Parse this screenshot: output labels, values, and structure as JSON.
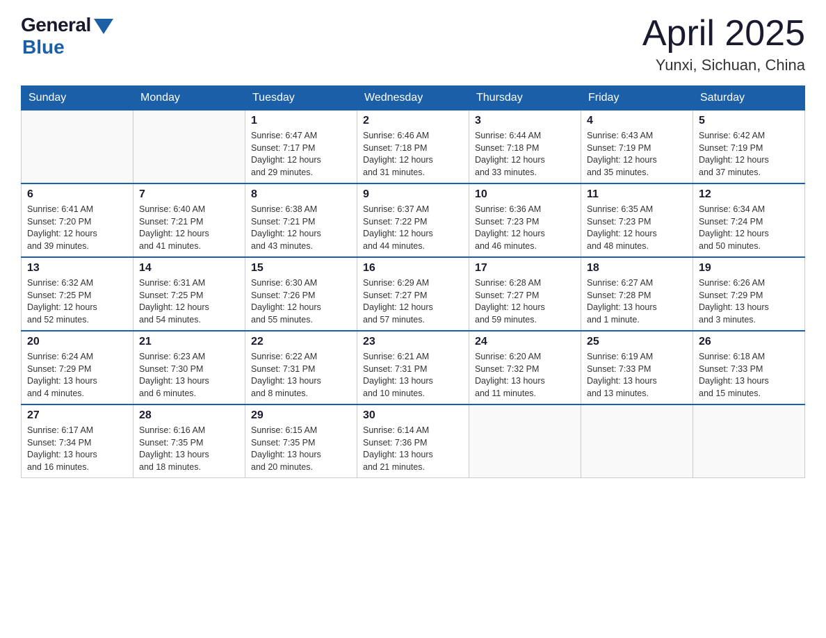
{
  "header": {
    "logo": {
      "general": "General",
      "blue": "Blue"
    },
    "title": "April 2025",
    "location": "Yunxi, Sichuan, China"
  },
  "days_of_week": [
    "Sunday",
    "Monday",
    "Tuesday",
    "Wednesday",
    "Thursday",
    "Friday",
    "Saturday"
  ],
  "weeks": [
    [
      {
        "day": "",
        "info": ""
      },
      {
        "day": "",
        "info": ""
      },
      {
        "day": "1",
        "info": "Sunrise: 6:47 AM\nSunset: 7:17 PM\nDaylight: 12 hours\nand 29 minutes."
      },
      {
        "day": "2",
        "info": "Sunrise: 6:46 AM\nSunset: 7:18 PM\nDaylight: 12 hours\nand 31 minutes."
      },
      {
        "day": "3",
        "info": "Sunrise: 6:44 AM\nSunset: 7:18 PM\nDaylight: 12 hours\nand 33 minutes."
      },
      {
        "day": "4",
        "info": "Sunrise: 6:43 AM\nSunset: 7:19 PM\nDaylight: 12 hours\nand 35 minutes."
      },
      {
        "day": "5",
        "info": "Sunrise: 6:42 AM\nSunset: 7:19 PM\nDaylight: 12 hours\nand 37 minutes."
      }
    ],
    [
      {
        "day": "6",
        "info": "Sunrise: 6:41 AM\nSunset: 7:20 PM\nDaylight: 12 hours\nand 39 minutes."
      },
      {
        "day": "7",
        "info": "Sunrise: 6:40 AM\nSunset: 7:21 PM\nDaylight: 12 hours\nand 41 minutes."
      },
      {
        "day": "8",
        "info": "Sunrise: 6:38 AM\nSunset: 7:21 PM\nDaylight: 12 hours\nand 43 minutes."
      },
      {
        "day": "9",
        "info": "Sunrise: 6:37 AM\nSunset: 7:22 PM\nDaylight: 12 hours\nand 44 minutes."
      },
      {
        "day": "10",
        "info": "Sunrise: 6:36 AM\nSunset: 7:23 PM\nDaylight: 12 hours\nand 46 minutes."
      },
      {
        "day": "11",
        "info": "Sunrise: 6:35 AM\nSunset: 7:23 PM\nDaylight: 12 hours\nand 48 minutes."
      },
      {
        "day": "12",
        "info": "Sunrise: 6:34 AM\nSunset: 7:24 PM\nDaylight: 12 hours\nand 50 minutes."
      }
    ],
    [
      {
        "day": "13",
        "info": "Sunrise: 6:32 AM\nSunset: 7:25 PM\nDaylight: 12 hours\nand 52 minutes."
      },
      {
        "day": "14",
        "info": "Sunrise: 6:31 AM\nSunset: 7:25 PM\nDaylight: 12 hours\nand 54 minutes."
      },
      {
        "day": "15",
        "info": "Sunrise: 6:30 AM\nSunset: 7:26 PM\nDaylight: 12 hours\nand 55 minutes."
      },
      {
        "day": "16",
        "info": "Sunrise: 6:29 AM\nSunset: 7:27 PM\nDaylight: 12 hours\nand 57 minutes."
      },
      {
        "day": "17",
        "info": "Sunrise: 6:28 AM\nSunset: 7:27 PM\nDaylight: 12 hours\nand 59 minutes."
      },
      {
        "day": "18",
        "info": "Sunrise: 6:27 AM\nSunset: 7:28 PM\nDaylight: 13 hours\nand 1 minute."
      },
      {
        "day": "19",
        "info": "Sunrise: 6:26 AM\nSunset: 7:29 PM\nDaylight: 13 hours\nand 3 minutes."
      }
    ],
    [
      {
        "day": "20",
        "info": "Sunrise: 6:24 AM\nSunset: 7:29 PM\nDaylight: 13 hours\nand 4 minutes."
      },
      {
        "day": "21",
        "info": "Sunrise: 6:23 AM\nSunset: 7:30 PM\nDaylight: 13 hours\nand 6 minutes."
      },
      {
        "day": "22",
        "info": "Sunrise: 6:22 AM\nSunset: 7:31 PM\nDaylight: 13 hours\nand 8 minutes."
      },
      {
        "day": "23",
        "info": "Sunrise: 6:21 AM\nSunset: 7:31 PM\nDaylight: 13 hours\nand 10 minutes."
      },
      {
        "day": "24",
        "info": "Sunrise: 6:20 AM\nSunset: 7:32 PM\nDaylight: 13 hours\nand 11 minutes."
      },
      {
        "day": "25",
        "info": "Sunrise: 6:19 AM\nSunset: 7:33 PM\nDaylight: 13 hours\nand 13 minutes."
      },
      {
        "day": "26",
        "info": "Sunrise: 6:18 AM\nSunset: 7:33 PM\nDaylight: 13 hours\nand 15 minutes."
      }
    ],
    [
      {
        "day": "27",
        "info": "Sunrise: 6:17 AM\nSunset: 7:34 PM\nDaylight: 13 hours\nand 16 minutes."
      },
      {
        "day": "28",
        "info": "Sunrise: 6:16 AM\nSunset: 7:35 PM\nDaylight: 13 hours\nand 18 minutes."
      },
      {
        "day": "29",
        "info": "Sunrise: 6:15 AM\nSunset: 7:35 PM\nDaylight: 13 hours\nand 20 minutes."
      },
      {
        "day": "30",
        "info": "Sunrise: 6:14 AM\nSunset: 7:36 PM\nDaylight: 13 hours\nand 21 minutes."
      },
      {
        "day": "",
        "info": ""
      },
      {
        "day": "",
        "info": ""
      },
      {
        "day": "",
        "info": ""
      }
    ]
  ]
}
